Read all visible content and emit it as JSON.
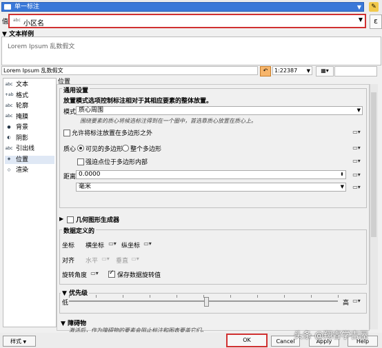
{
  "mode": {
    "label": "单一标注"
  },
  "value": {
    "label": "值",
    "field_tag": "abc",
    "field": "小区名",
    "expr_icon": "ε"
  },
  "sample": {
    "header": "文本样例",
    "text": "Lorem Ipsum 乱数假文",
    "input": "Lorem Ipsum 乱数假文",
    "scale": "1:22387"
  },
  "sidebar": {
    "items": [
      {
        "icon": "abc",
        "label": "文本"
      },
      {
        "icon": "+ab",
        "label": "格式"
      },
      {
        "icon": "abc",
        "label": "轮廓"
      },
      {
        "icon": "abc",
        "label": "掩膜"
      },
      {
        "icon": "●",
        "label": "背景"
      },
      {
        "icon": "◐",
        "label": "阴影"
      },
      {
        "icon": "abc",
        "label": "引出线"
      },
      {
        "icon": "◈",
        "label": "位置"
      },
      {
        "icon": "◇",
        "label": "渲染"
      }
    ],
    "selected_index": 7
  },
  "panel": {
    "title": "位置",
    "general": {
      "legend": "通用设置",
      "headline": "放置模式选项控制标注相对于其相应要素的整体放置。",
      "mode_label": "模式",
      "mode_value": "质心周围",
      "mode_hint": "围绕要素的质心将候选标注得到在一个圈中，首选靠质心放置在质心上。",
      "allow_outside": "允许将标注放置在多边形之外",
      "centroid_label": "质心",
      "radio_visible": "可见的多边形",
      "radio_whole": "整个多边形",
      "force_inside": "强迫点位于多边形内部",
      "distance_label": "距离",
      "distance_value": "0.0000",
      "unit_value": "毫米"
    },
    "geometry_generator": {
      "label": "几何图形生成器"
    },
    "data_defined": {
      "legend": "数据定义的",
      "coord_label": "坐标",
      "x_label": "横坐标",
      "y_label": "纵坐标",
      "align_label": "对齐",
      "h_label": "水平",
      "v_label": "垂直",
      "rotation_label": "旋转角度",
      "keep_rotation": "保存数据旋转值"
    },
    "priority": {
      "legend": "优先级",
      "low": "低",
      "high": "高",
      "value": 0.5
    },
    "obstacles": {
      "legend": "障碍物",
      "hint": "激活后，作为障碍物的要素会阻止标注和图表要盖它们。"
    }
  },
  "footer": {
    "style_label": "样式",
    "ok": "OK",
    "cancel": "Cancel",
    "apply": "Apply",
    "help": "Help"
  },
  "watermark": "头条 @翔睿学吉屋"
}
